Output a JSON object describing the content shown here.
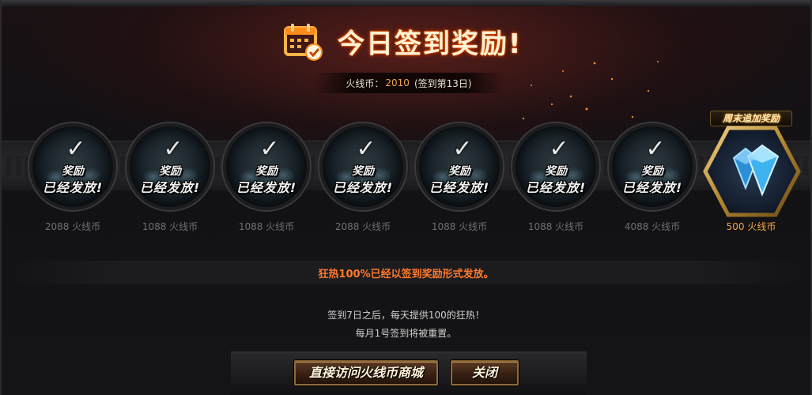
{
  "window": {
    "top_strip_text": "···  ···  ···  ···"
  },
  "header": {
    "title": "今日签到奖励!",
    "calendar_icon": "calendar-check-icon"
  },
  "coin_status": {
    "label": "火线币：",
    "value": "2010",
    "day_text": "(签到第13日)"
  },
  "days": [
    {
      "stamp_line1": "奖励",
      "stamp_line2": "已经发放!",
      "reward": "2088 火线币",
      "claimed": true
    },
    {
      "stamp_line1": "奖励",
      "stamp_line2": "已经发放!",
      "reward": "1088 火线币",
      "claimed": true
    },
    {
      "stamp_line1": "奖励",
      "stamp_line2": "已经发放!",
      "reward": "1088 火线币",
      "claimed": true
    },
    {
      "stamp_line1": "奖励",
      "stamp_line2": "已经发放!",
      "reward": "2088 火线币",
      "claimed": true
    },
    {
      "stamp_line1": "奖励",
      "stamp_line2": "已经发放!",
      "reward": "1088 火线币",
      "claimed": true
    },
    {
      "stamp_line1": "奖励",
      "stamp_line2": "已经发放!",
      "reward": "1088 火线币",
      "claimed": true
    },
    {
      "stamp_line1": "奖励",
      "stamp_line2": "已经发放!",
      "reward": "4088 火线币",
      "claimed": true
    }
  ],
  "weekend_bonus": {
    "tag": "周末追加奖励",
    "reward": "500 火线币",
    "icon": "diamond-coin-icon"
  },
  "notices": {
    "fever": "狂热100%已经以签到奖励形式发放。",
    "line1": "签到7日之后，每天提供100的狂热！",
    "line2": "每月1号签到将被重置。"
  },
  "buttons": {
    "shop": "直接访问火线币商城",
    "close": "关闭"
  },
  "colors": {
    "accent_orange": "#ff7a2b",
    "coin_gold": "#f0a443",
    "muted_text": "#6f6f74"
  }
}
